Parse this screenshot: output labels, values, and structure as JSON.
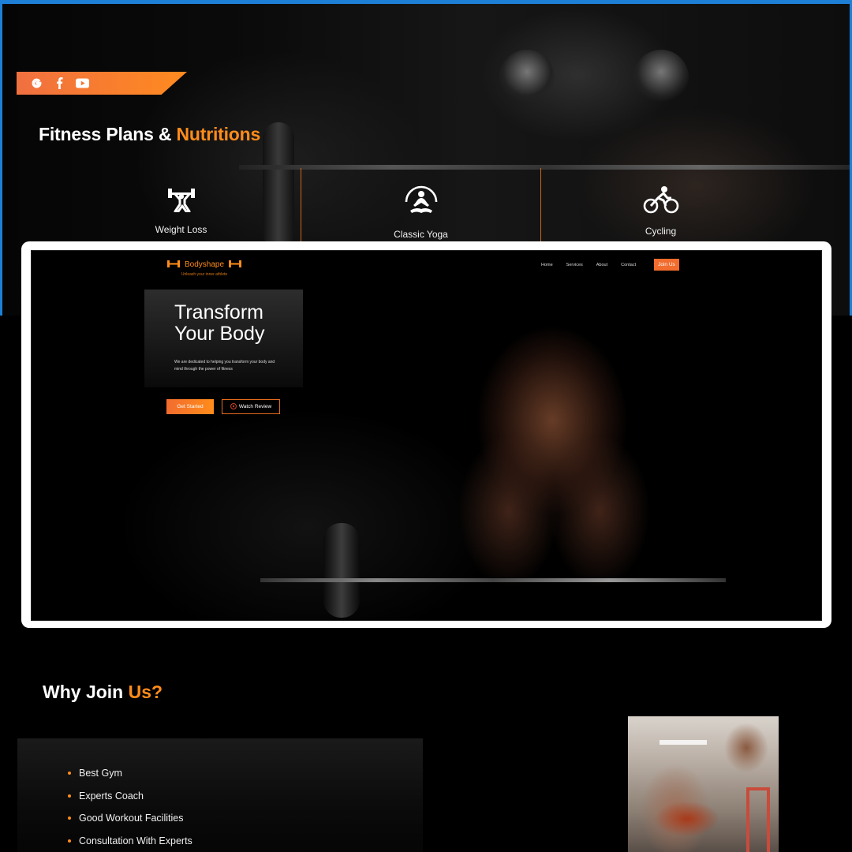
{
  "plans_section": {
    "heading_main": "Fitness Plans &",
    "heading_accent": "Nutritions",
    "social_icons": [
      "google-icon",
      "facebook-icon",
      "youtube-icon"
    ],
    "items": [
      {
        "label": "Weight Loss",
        "icon": "weightlifting-icon"
      },
      {
        "label": "Classic Yoga",
        "icon": "yoga-icon"
      },
      {
        "label": "Cycling",
        "icon": "cycling-icon"
      }
    ]
  },
  "preview": {
    "brand": "Bodyshape",
    "tagline": "Unleash your inner athlete",
    "nav": [
      "Home",
      "Services",
      "About",
      "Contact"
    ],
    "join_label": "Join Us",
    "hero_title_line1": "Transform",
    "hero_title_line2": "Your Body",
    "hero_text": "We are dedicated to helping you transform your body and mind through the power of fitness",
    "primary_button": "Get Started",
    "secondary_button": "Watch Review"
  },
  "why_section": {
    "heading_main": "Why Join",
    "heading_accent": "Us?",
    "features": [
      "Best Gym",
      "Experts Coach",
      "Good Workout Facilities",
      "Consultation With Experts"
    ]
  },
  "colors": {
    "accent": "#ff8c1a",
    "accent_dark": "#f26c2e",
    "frame_border": "#1e7fd6"
  }
}
